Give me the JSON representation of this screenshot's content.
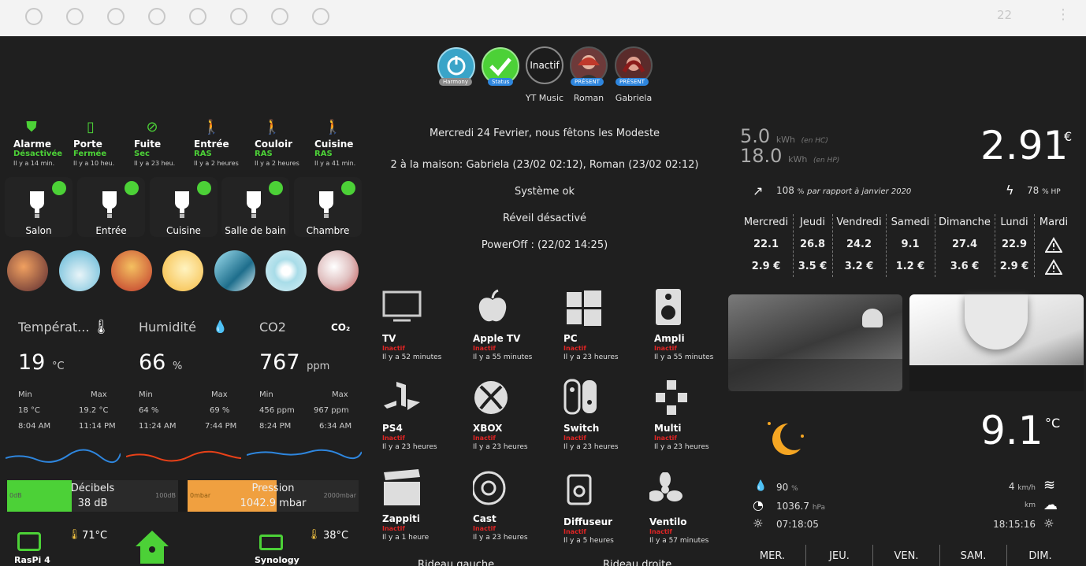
{
  "topbar": {
    "icons": [
      "home-icon",
      "robot-icon",
      "bolt-icon",
      "circle-icon",
      "gear-icon",
      "camera-icon",
      "settings-icon",
      "dots-icon"
    ],
    "lang_label": "22",
    "menu_icon": "kebab-icon"
  },
  "header_circles": [
    {
      "name": "Harmony",
      "badge": "Harmony",
      "color": "#3aa4c8"
    },
    {
      "name": "Status",
      "badge": "Status",
      "color": "#4cd137"
    },
    {
      "name": "YT Music",
      "text": "Inactif",
      "label": "YT Music"
    },
    {
      "name": "Roman",
      "badge": "PRÉSENT",
      "label": "Roman"
    },
    {
      "name": "Gabriela",
      "badge": "PRÉSENT",
      "label": "Gabriela"
    }
  ],
  "status": [
    {
      "name": "Alarme",
      "value": "Désactivée",
      "time": "Il y a 14 min."
    },
    {
      "name": "Porte",
      "value": "Fermée",
      "time": "Il y a 10 heu."
    },
    {
      "name": "Fuite",
      "value": "Sec",
      "time": "Il y a 23 heu."
    },
    {
      "name": "Entrée",
      "value": "RAS",
      "time": "Il y a 2 heures"
    },
    {
      "name": "Couloir",
      "value": "RAS",
      "time": "Il y a 2 heures"
    },
    {
      "name": "Cuisine",
      "value": "RAS",
      "time": "Il y a 41 min."
    }
  ],
  "lights": [
    "Salon",
    "Entrée",
    "Cuisine",
    "Salle de bain",
    "Chambre"
  ],
  "scenes": [
    "sunset-palm",
    "sky-blue",
    "sunset-red",
    "sun-yellow",
    "waves",
    "light-blue",
    "red-flowers"
  ],
  "sensors": [
    {
      "title": "Températ...",
      "value": "19",
      "unit": "°C",
      "min_label": "Min",
      "max_label": "Max",
      "min": "18 °C",
      "max": "19.2 °C",
      "min_time": "8:04 AM",
      "max_time": "11:14 PM",
      "color": "#2e86de"
    },
    {
      "title": "Humidité",
      "value": "66",
      "unit": "%",
      "min_label": "Min",
      "max_label": "Max",
      "min": "64 %",
      "max": "69 %",
      "min_time": "11:24 AM",
      "max_time": "7:44 PM",
      "color": "#e84118"
    },
    {
      "title": "CO2",
      "value": "767",
      "unit": "ppm",
      "min_label": "Min",
      "max_label": "Max",
      "min": "456 ppm",
      "max": "967 ppm",
      "min_time": "8:24 PM",
      "max_time": "6:34 AM",
      "color": "#2e86de"
    }
  ],
  "decibels": {
    "label": "Décibels",
    "value": "38 dB",
    "min": "0dB",
    "max": "100dB",
    "fraction": 0.38
  },
  "pression": {
    "label": "Pression",
    "value": "1042.9 mbar",
    "min": "0mbar",
    "max": "2000mbar",
    "fraction": 0.52
  },
  "system": [
    {
      "name": "RasPi 4",
      "temp": "71°C"
    },
    {
      "name": "Home Assistant",
      "temp": ""
    },
    {
      "name": "Synology",
      "temp": "38°C"
    }
  ],
  "info": {
    "date_line": "Mercredi 24 Fevrier, nous fêtons les Modeste",
    "home_line": "2 à la maison: Gabriela (23/02 02:12), Roman (23/02 02:12)",
    "system_line": "Système ok",
    "alarm_line": "Réveil désactivé",
    "power_line": "PowerOff : (22/02 14:25)",
    "rideau_left": "Rideau gauche",
    "rideau_right": "Rideau droite"
  },
  "devices": [
    {
      "name": "TV",
      "state": "Inactif",
      "time": "Il y a 52 minutes"
    },
    {
      "name": "Apple TV",
      "state": "Inactif",
      "time": "Il y a 55 minutes"
    },
    {
      "name": "PC",
      "state": "Inactif",
      "time": "Il y a 23 heures"
    },
    {
      "name": "Ampli",
      "state": "Inactif",
      "time": "Il y a 55 minutes"
    },
    {
      "name": "PS4",
      "state": "Inactif",
      "time": "Il y a 23 heures"
    },
    {
      "name": "XBOX",
      "state": "Inactif",
      "time": "Il y a 23 heures"
    },
    {
      "name": "Switch",
      "state": "Inactif",
      "time": "Il y a 23 heures"
    },
    {
      "name": "Multi",
      "state": "Inactif",
      "time": "Il y a 23 heures"
    },
    {
      "name": "Zappiti",
      "state": "Inactif",
      "time": "Il y a 1 heure"
    },
    {
      "name": "Cast",
      "state": "Inactif",
      "time": "Il y a 23 heures"
    },
    {
      "name": "Diffuseur",
      "state": "Inactif",
      "time": "Il y a 5 heures"
    },
    {
      "name": "Ventilo",
      "state": "Inactif",
      "time": "Il y a 57 minutes"
    }
  ],
  "energy": {
    "hc_value": "5.0",
    "hc_unit": "kWh",
    "hc_label": "(en HC)",
    "hp_value": "18.0",
    "hp_unit": "kWh",
    "hp_label": "(en HP)",
    "cost": "2.91",
    "currency": "€",
    "compare_value": "108",
    "compare_unit": "%",
    "compare_text": "par rapport à janvier 2020",
    "hp_pct": "78",
    "hp_pct_unit": "% HP",
    "days": [
      "Mercredi",
      "Jeudi",
      "Vendredi",
      "Samedi",
      "Dimanche",
      "Lundi",
      "Mardi"
    ],
    "kwh": [
      "22.1",
      "26.8",
      "24.2",
      "9.1",
      "27.4",
      "22.9",
      ""
    ],
    "eur": [
      "2.9 €",
      "3.5 €",
      "3.2 €",
      "1.2 €",
      "3.6 €",
      "2.9 €",
      ""
    ]
  },
  "weather": {
    "temp": "9.1",
    "unit": "°C",
    "humidity": "90",
    "humidity_unit": "%",
    "pressure": "1036.7",
    "pressure_unit": "hPa",
    "sunrise": "07:18:05",
    "sunset": "18:15:16",
    "wind": "4",
    "wind_unit": "km/h",
    "visibility_unit": "km",
    "forecast": [
      "MER.",
      "JEU.",
      "VEN.",
      "SAM.",
      "DIM."
    ]
  }
}
